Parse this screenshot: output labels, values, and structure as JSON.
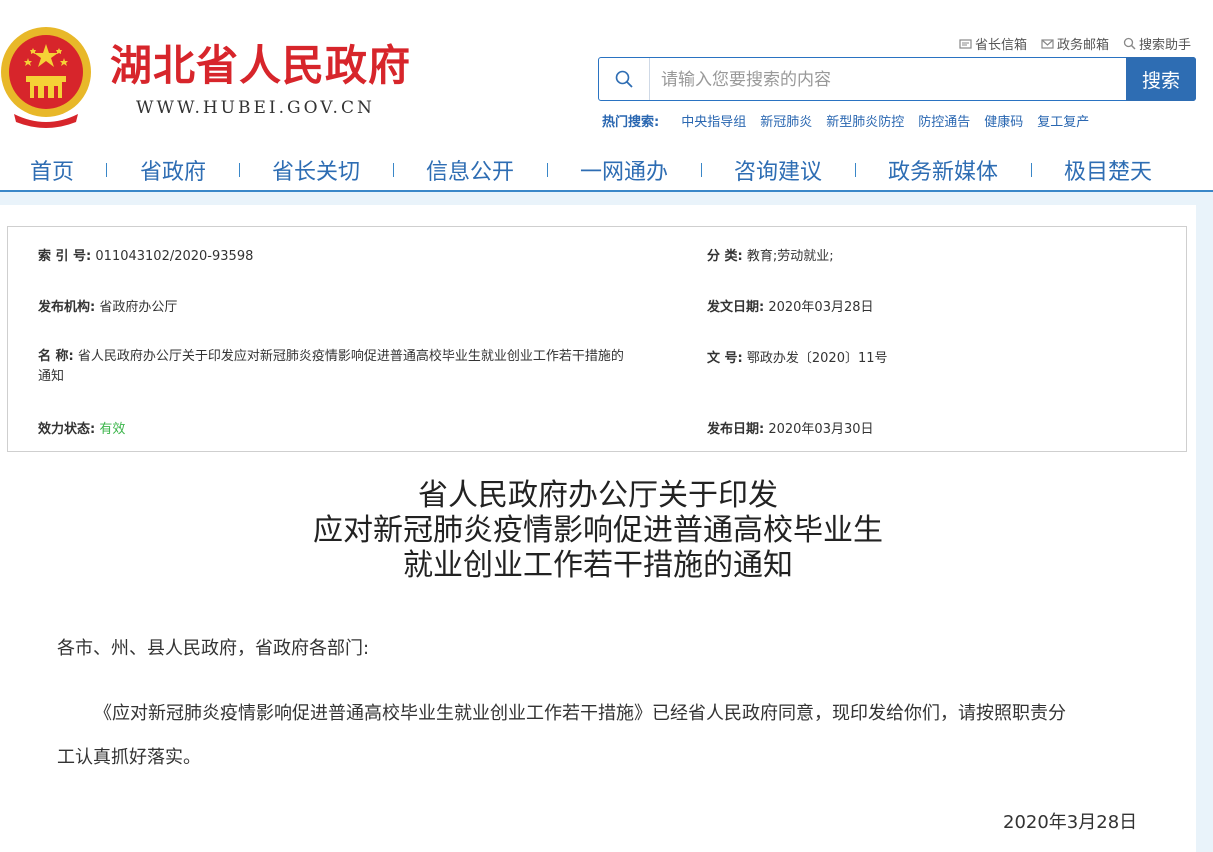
{
  "header": {
    "site_name": "湖北省人民政府",
    "site_url": "WWW.HUBEI.GOV.CN",
    "top_links": [
      "省长信箱",
      "政务邮箱",
      "搜索助手"
    ],
    "search": {
      "placeholder": "请输入您要搜索的内容",
      "button": "搜索"
    },
    "hot_label": "热门搜索:",
    "hot_items": [
      "中央指导组",
      "新冠肺炎",
      "新型肺炎防控",
      "防控通告",
      "健康码",
      "复工复产"
    ]
  },
  "nav": [
    "首页",
    "省政府",
    "省长关切",
    "信息公开",
    "一网通办",
    "咨询建议",
    "政务新媒体",
    "极目楚天"
  ],
  "meta": {
    "index_label": "索 引 号:",
    "index_value": "011043102/2020-93598",
    "category_label": "分 类:",
    "category_value": "教育;劳动就业;",
    "issuer_label": "发布机构:",
    "issuer_value": "省政府办公厅",
    "doc_date_label": "发文日期:",
    "doc_date_value": "2020年03月28日",
    "name_label": "名 称:",
    "name_value_line1": "省人民政府办公厅关于印发应对新冠肺炎疫情影响促进普通高校毕业生就业创业工作若干措施的",
    "name_value_line2": "通知",
    "doc_no_label": "文 号:",
    "doc_no_value": "鄂政办发〔2020〕11号",
    "status_label": "效力状态:",
    "status_value": "有效",
    "publish_date_label": "发布日期:",
    "publish_date_value": "2020年03月30日",
    "status_color": "#3bb54a"
  },
  "article": {
    "title_lines": [
      "省人民政府办公厅关于印发",
      "应对新冠肺炎疫情影响促进普通高校毕业生",
      "就业创业工作若干措施的通知"
    ],
    "salutation": "各市、州、县人民政府，省政府各部门:",
    "body_line1": "《应对新冠肺炎疫情影响促进普通高校毕业生就业创业工作若干措施》已经省人民政府同意，现印发给你们，请按照职责分",
    "body_line2": "工认真抓好落实。",
    "date": "2020年3月28日"
  },
  "colors": {
    "brand_red": "#d7252b",
    "nav_blue": "#2e6db3",
    "background": "#e9f3fa"
  }
}
